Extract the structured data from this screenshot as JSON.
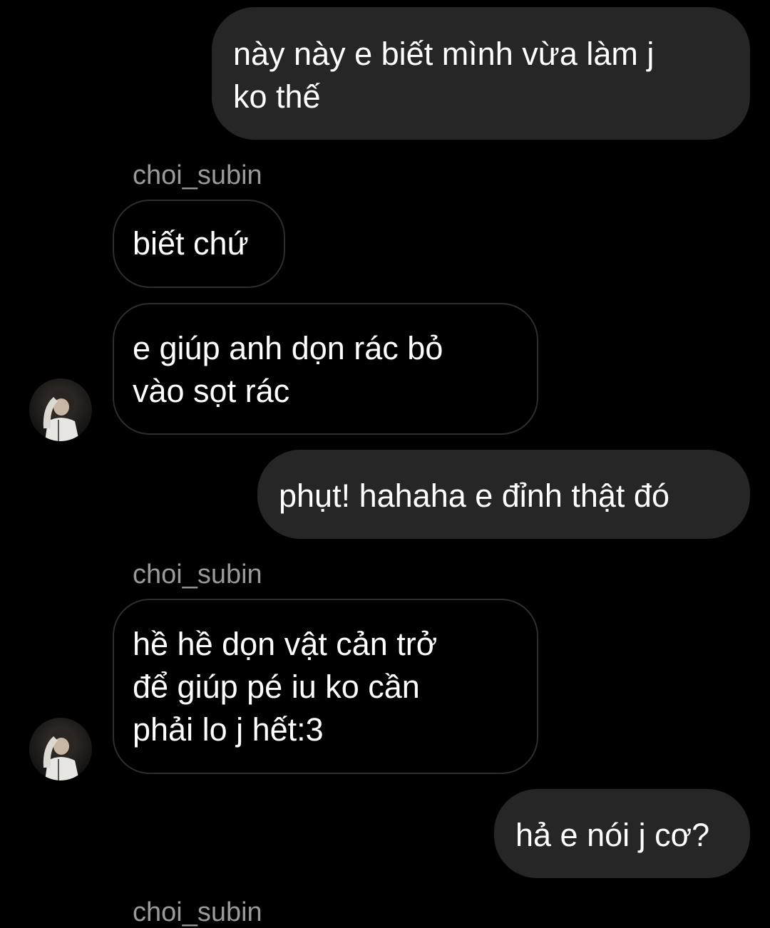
{
  "colors": {
    "background": "#000000",
    "outgoing_bubble": "#262626",
    "incoming_border": "#2e2e2e",
    "sender_text": "#9a9a9a",
    "message_text": "#ffffff"
  },
  "messages": [
    {
      "direction": "outgoing",
      "text": "này này e biết mình vừa làm j\nko thế"
    },
    {
      "direction": "incoming",
      "sender": "choi_subin",
      "text": "biết chứ"
    },
    {
      "direction": "incoming",
      "text": "e giúp anh dọn rác bỏ\nvào sọt rác",
      "avatar": "profile-photo"
    },
    {
      "direction": "outgoing",
      "text": "phụt! hahaha e đỉnh thật đó"
    },
    {
      "direction": "incoming",
      "sender": "choi_subin",
      "text": "hề hề dọn vật cản trở\nđể giúp pé iu ko cần\nphải lo j hết:3",
      "avatar": "profile-photo"
    },
    {
      "direction": "outgoing",
      "text": "hả e nói j cơ?"
    }
  ],
  "partial_sender": "choi_subin"
}
